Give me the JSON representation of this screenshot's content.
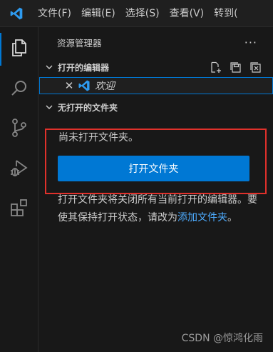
{
  "menubar": {
    "items": [
      "文件(F)",
      "编辑(E)",
      "选择(S)",
      "查看(V)",
      "转到("
    ]
  },
  "activity_bar": {
    "items": [
      {
        "icon": "files-icon",
        "active": true
      },
      {
        "icon": "search-icon",
        "active": false
      },
      {
        "icon": "source-control-icon",
        "active": false
      },
      {
        "icon": "run-debug-icon",
        "active": false
      },
      {
        "icon": "extensions-icon",
        "active": false
      }
    ]
  },
  "sidebar": {
    "title": "资源管理器",
    "more": "···",
    "open_editors": {
      "title": "打开的编辑器",
      "items": [
        {
          "label": "欢迎",
          "close": "✕"
        }
      ]
    },
    "no_folder": {
      "title": "无打开的文件夹",
      "message": "尚未打开文件夹。",
      "button_label": "打开文件夹",
      "description": "打开文件夹将关闭所有当前打开的编辑器。要使其保持打开状态，请改为",
      "link_label": "添加文件夹",
      "link_suffix": "。"
    }
  },
  "watermark": "CSDN @惊鸿化雨",
  "colors": {
    "accent": "#0078d4",
    "highlight_box": "#e0312b",
    "link": "#4daafc"
  }
}
